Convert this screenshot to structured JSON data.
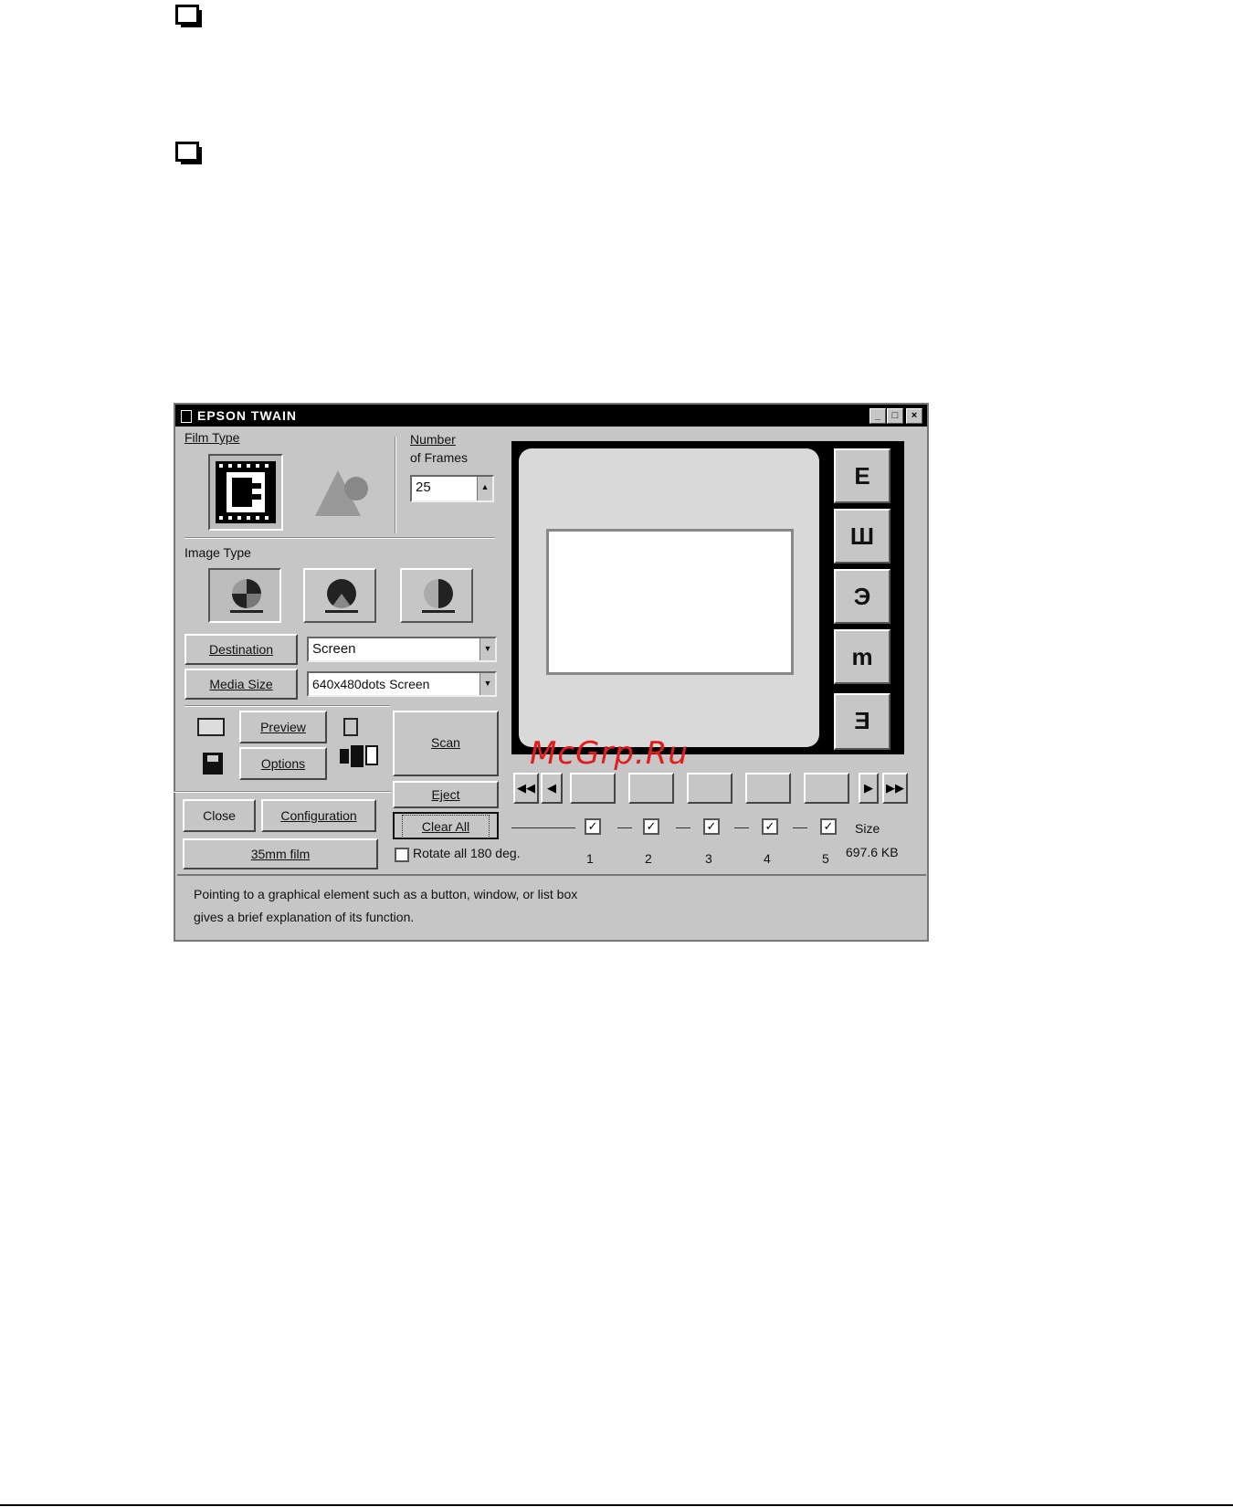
{
  "window": {
    "title": "EPSON TWAIN",
    "minimize": "_",
    "maximize": "□",
    "close": "×"
  },
  "film_type": {
    "label": "Film Type"
  },
  "frames": {
    "label_line1": "Number",
    "label_line2": "of Frames",
    "value": "25"
  },
  "image_type": {
    "label": "Image Type"
  },
  "destination": {
    "button": "Destination",
    "value": "Screen"
  },
  "media_size": {
    "button": "Media Size",
    "value": "640x480dots Screen"
  },
  "actions": {
    "preview": "Preview",
    "options": "Options",
    "scan": "Scan",
    "eject": "Eject",
    "clear_all": "Clear All",
    "close": "Close",
    "configuration": "Configuration",
    "film": "35mm film"
  },
  "rotate": {
    "label": "Rotate all 180 deg."
  },
  "frame_numbers": [
    "1",
    "2",
    "3",
    "4",
    "5"
  ],
  "size": {
    "label": "Size",
    "value": "697.6 KB"
  },
  "tools": [
    "E",
    "Ш",
    "Э",
    "m",
    "Ǝ"
  ],
  "status_text": {
    "line1": "Pointing to a graphical element such as a button, window, or list box",
    "line2": "gives a brief explanation of its function."
  },
  "watermark": "McGrp.Ru"
}
